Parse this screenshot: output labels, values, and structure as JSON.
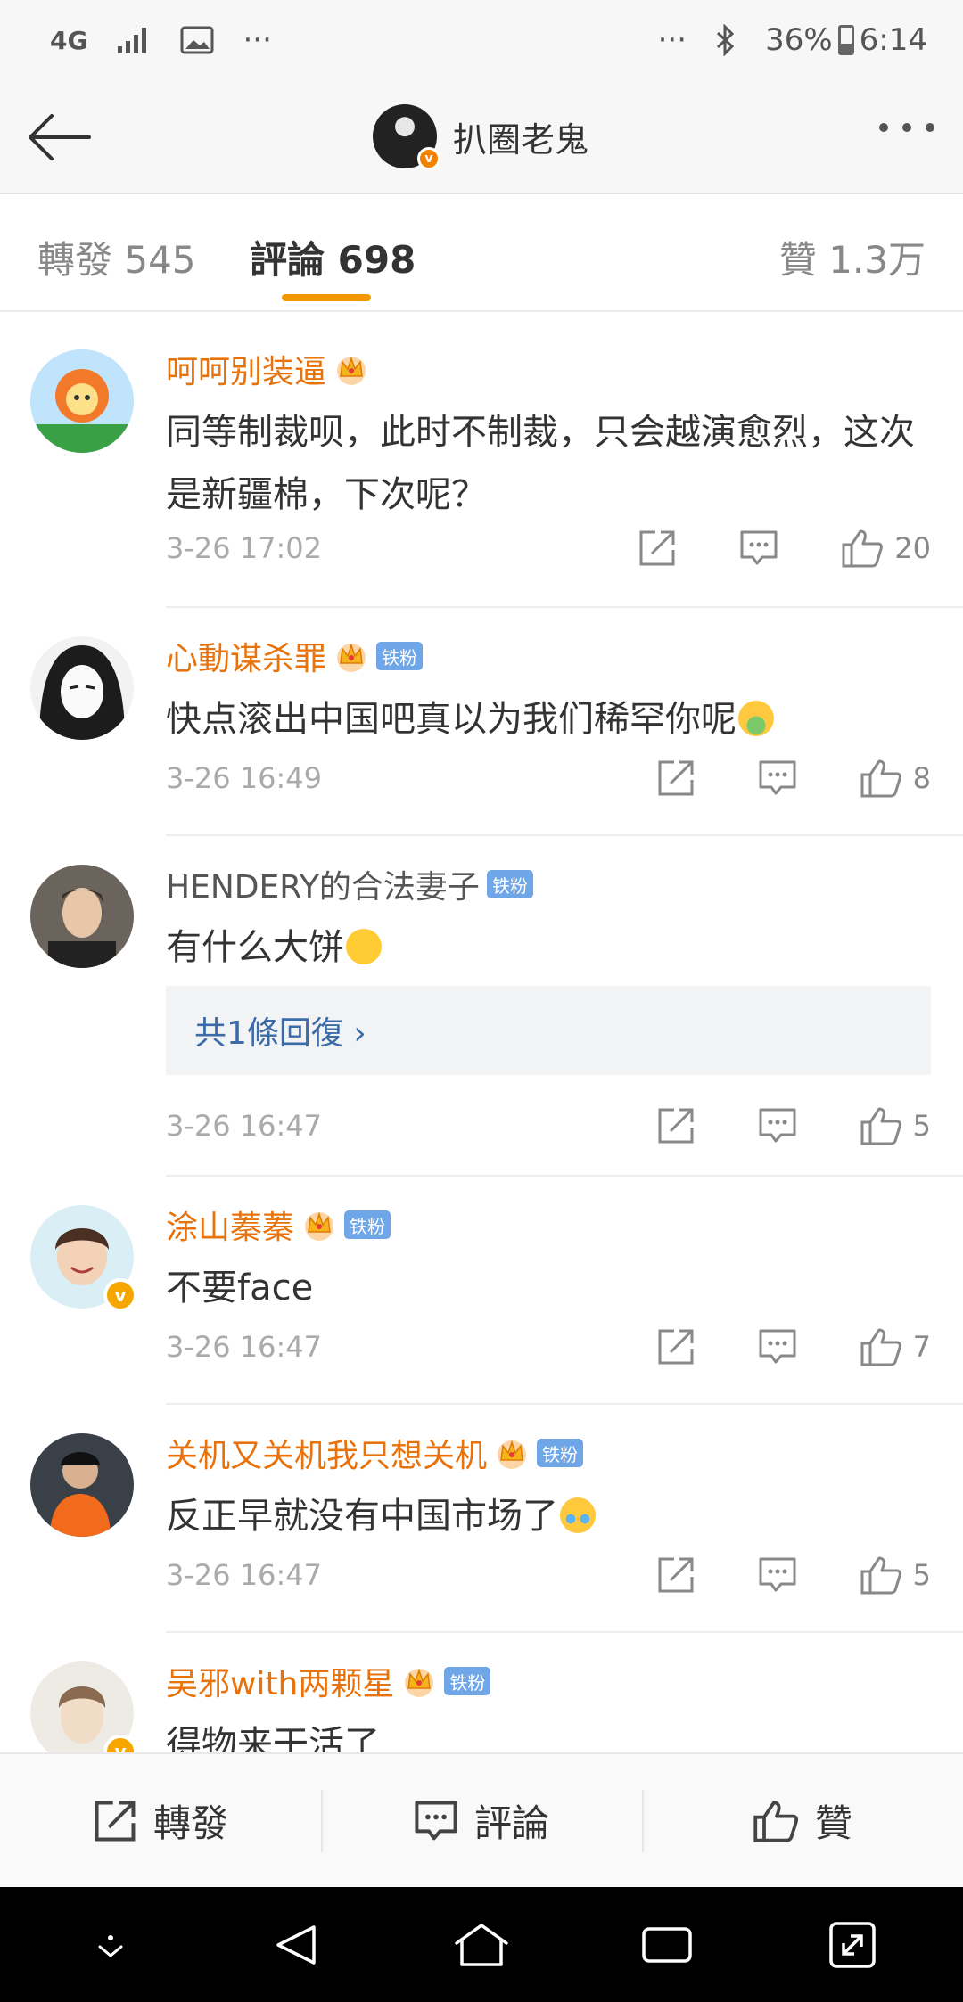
{
  "status_bar": {
    "network": "4G",
    "more": "···",
    "more_right": "···",
    "battery": "36%",
    "battery_level": 0.36,
    "time": "6:14"
  },
  "header": {
    "title": "扒圈老鬼"
  },
  "tabs": [
    {
      "label": "轉發 545"
    },
    {
      "label": "評論 698"
    },
    {
      "label": "贊 1.3万"
    }
  ],
  "comments": [
    {
      "username": "呵呵别装逼",
      "text": "同等制裁呗，此时不制裁，只会越演愈烈，这次是新疆棉，下次呢？",
      "time": "3-26 17:02",
      "likes": "20"
    },
    {
      "username": "心動谋杀罪",
      "badge": "铁粉",
      "text": "快点滚出中国吧真以为我们稀罕你呢",
      "time": "3-26 16:49",
      "likes": "8"
    },
    {
      "username": "HENDERY的合法妻子",
      "badge": "铁粉",
      "text": "有什么大饼",
      "reply_link": "共1條回復 ›",
      "time": "3-26 16:47",
      "likes": "5"
    },
    {
      "username": "涂山蓁蓁",
      "badge": "铁粉",
      "text": "不要face",
      "time": "3-26 16:47",
      "likes": "7"
    },
    {
      "username": "关机又关机我只想关机",
      "badge": "铁粉",
      "text": "反正早就没有中国市场了",
      "time": "3-26 16:47",
      "likes": "5"
    },
    {
      "username": "吴邪with两颗星",
      "badge": "铁粉",
      "text": "得物来干活了"
    }
  ],
  "bottom_bar": {
    "repost": "轉發",
    "comment": "評論",
    "like": "贊"
  },
  "colors": {
    "accent": "#f39800",
    "username": "#e8720c",
    "fan_badge": "#6ea6e8",
    "reply_link": "#3b6ba8"
  },
  "icons": [
    "back-arrow-icon",
    "more-dots-icon",
    "share-icon",
    "comment-icon",
    "thumbs-up-icon",
    "crown-icon",
    "nav-down-icon",
    "nav-back-icon",
    "nav-home-icon",
    "nav-recents-icon",
    "nav-expand-icon"
  ]
}
